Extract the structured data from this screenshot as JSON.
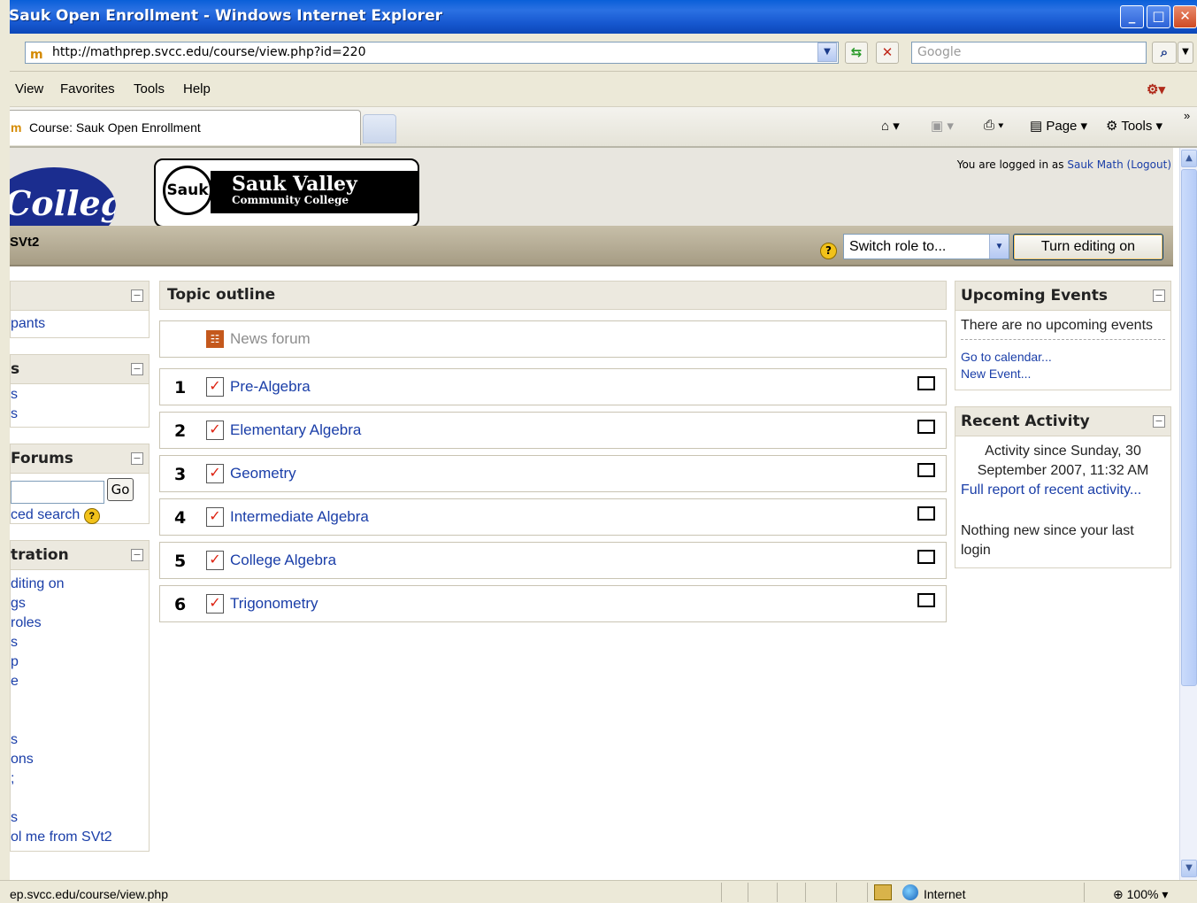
{
  "window": {
    "title": "Sauk Open Enrollment - Windows Internet Explorer",
    "min": "_",
    "max": "□",
    "close": "✕"
  },
  "address": {
    "url": "http://mathprep.svcc.edu/course/view.php?id=220",
    "search_placeholder": "Google"
  },
  "menu": {
    "items": [
      "View",
      "Favorites",
      "Tools",
      "Help"
    ]
  },
  "tabs": {
    "active": "Course: Sauk Open Enrollment"
  },
  "commandbar": {
    "page": "Page",
    "tools": "Tools"
  },
  "header": {
    "college_logo": "College",
    "svcc_circle": "Sauk",
    "svcc_name": "Sauk Valley",
    "svcc_sub": "Community College",
    "logged_prefix": "You are logged in as",
    "user": "Sauk Math",
    "logout": "(Logout)"
  },
  "navbar": {
    "crumb": "SVt2",
    "role_select": "Switch role to...",
    "edit_button": "Turn editing on",
    "help": "?"
  },
  "left": {
    "people": {
      "links": [
        "pants"
      ]
    },
    "activities": {
      "title": "s",
      "links": [
        "s",
        "s"
      ]
    },
    "search": {
      "title": "Forums",
      "go": "Go",
      "advanced": "ced search"
    },
    "admin": {
      "title": "tration",
      "links": [
        "diting on",
        "gs",
        "roles",
        "s",
        "p",
        "e",
        "",
        "",
        "s",
        "ons",
        ";",
        "",
        "s",
        "ol me from SVt2"
      ]
    }
  },
  "center": {
    "heading": "Topic outline",
    "news_forum": "News forum",
    "topics": [
      {
        "num": "1",
        "title": "Pre-Algebra"
      },
      {
        "num": "2",
        "title": "Elementary Algebra"
      },
      {
        "num": "3",
        "title": "Geometry"
      },
      {
        "num": "4",
        "title": "Intermediate Algebra"
      },
      {
        "num": "5",
        "title": "College Algebra"
      },
      {
        "num": "6",
        "title": "Trigonometry"
      }
    ]
  },
  "right": {
    "upcoming": {
      "title": "Upcoming Events",
      "none": "There are no upcoming events",
      "calendar": "Go to calendar...",
      "new_event": "New Event..."
    },
    "recent": {
      "title": "Recent Activity",
      "since": "Activity since Sunday, 30 September 2007, 11:32 AM",
      "full_report": "Full report of recent activity...",
      "nothing": "Nothing new since your last login"
    }
  },
  "status": {
    "url": "ep.svcc.edu/course/view.php",
    "zone": "Internet",
    "zoom": "100%"
  }
}
